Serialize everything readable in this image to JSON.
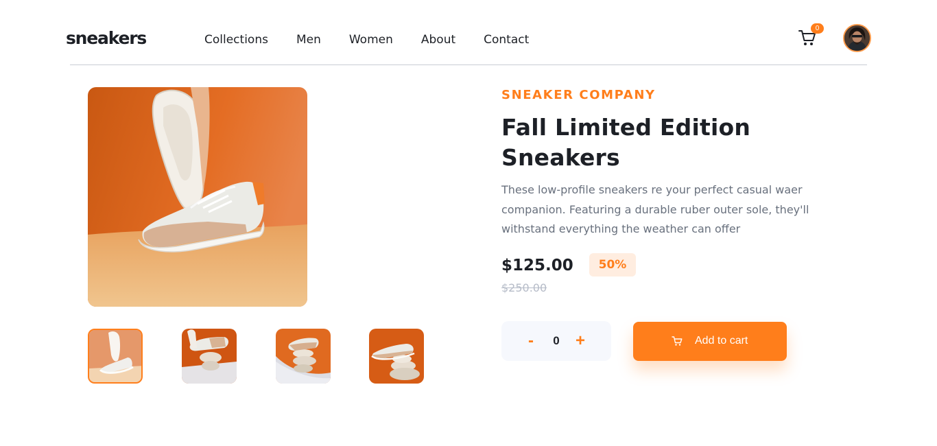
{
  "header": {
    "logo": "sneakers",
    "nav": [
      "Collections",
      "Men",
      "Women",
      "About",
      "Contact"
    ],
    "cart_count": "0"
  },
  "product": {
    "company": "SNEAKER COMPANY",
    "title": "Fall Limited Edition Sneakers",
    "description": "These low-profile sneakers re your perfect casual waer companion. Featuring a durable ruber outer sole, they'll withstand everything the weather can offer",
    "price": "$125.00",
    "discount": "50%",
    "old_price": "$250.00"
  },
  "cart_controls": {
    "minus": "-",
    "quantity": "0",
    "plus": "+",
    "add_label": "Add to cart"
  },
  "colors": {
    "accent": "#ff7e1b",
    "accent_pale": "#ffede0",
    "text_dark": "#1d2026",
    "text_gray": "#68707d"
  },
  "icons": {
    "cart": "cart-icon",
    "avatar": "user-avatar"
  }
}
